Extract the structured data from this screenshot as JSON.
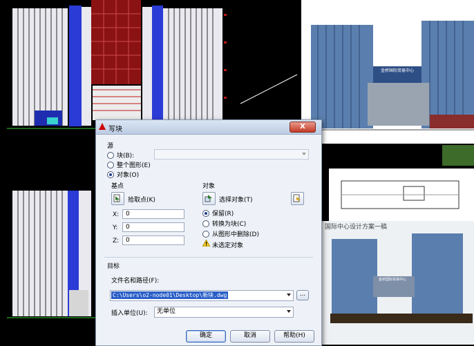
{
  "dialog": {
    "title": "写块",
    "close_glyph": "X",
    "source": {
      "group_label": "源",
      "block_label": "块(B):",
      "entire_drawing_label": "整个图形(E)",
      "objects_label": "对象(O)",
      "selected": "objects"
    },
    "base_point": {
      "group_label": "基点",
      "pick_label": "拾取点(K)",
      "x_label": "X:",
      "x_value": "0",
      "y_label": "Y:",
      "y_value": "0",
      "z_label": "Z:",
      "z_value": "0"
    },
    "objects": {
      "group_label": "对象",
      "select_label": "选择对象(T)",
      "retain_label": "保留(R)",
      "convert_label": "转换为块(C)",
      "delete_label": "从图形中删除(D)",
      "selected": "retain",
      "warning_text": "未选定对象"
    },
    "target": {
      "group_label": "目标",
      "path_label": "文件名和路径(F):",
      "path_value": "C:\\Users\\o2-node01\\Desktop\\新块.dwg",
      "browse_label": "...",
      "units_label": "插入单位(U):",
      "units_value": "无单位"
    },
    "buttons": {
      "ok": "确定",
      "cancel": "取消",
      "help": "帮助(H)"
    }
  },
  "background": {
    "sheet_title_1": "金桥国际贸易中心",
    "sheet_title_2": "国际中心设计方案一稿",
    "sheet_title_3": "金桥国际贸易中心"
  },
  "colors": {
    "cad_bg": "#000000",
    "cad_blue": "#2b3bd6",
    "cad_red": "#c01818",
    "dialog_bg": "#eef2f8",
    "selection": "#2a5fc8",
    "glass": "#5a7fae"
  }
}
